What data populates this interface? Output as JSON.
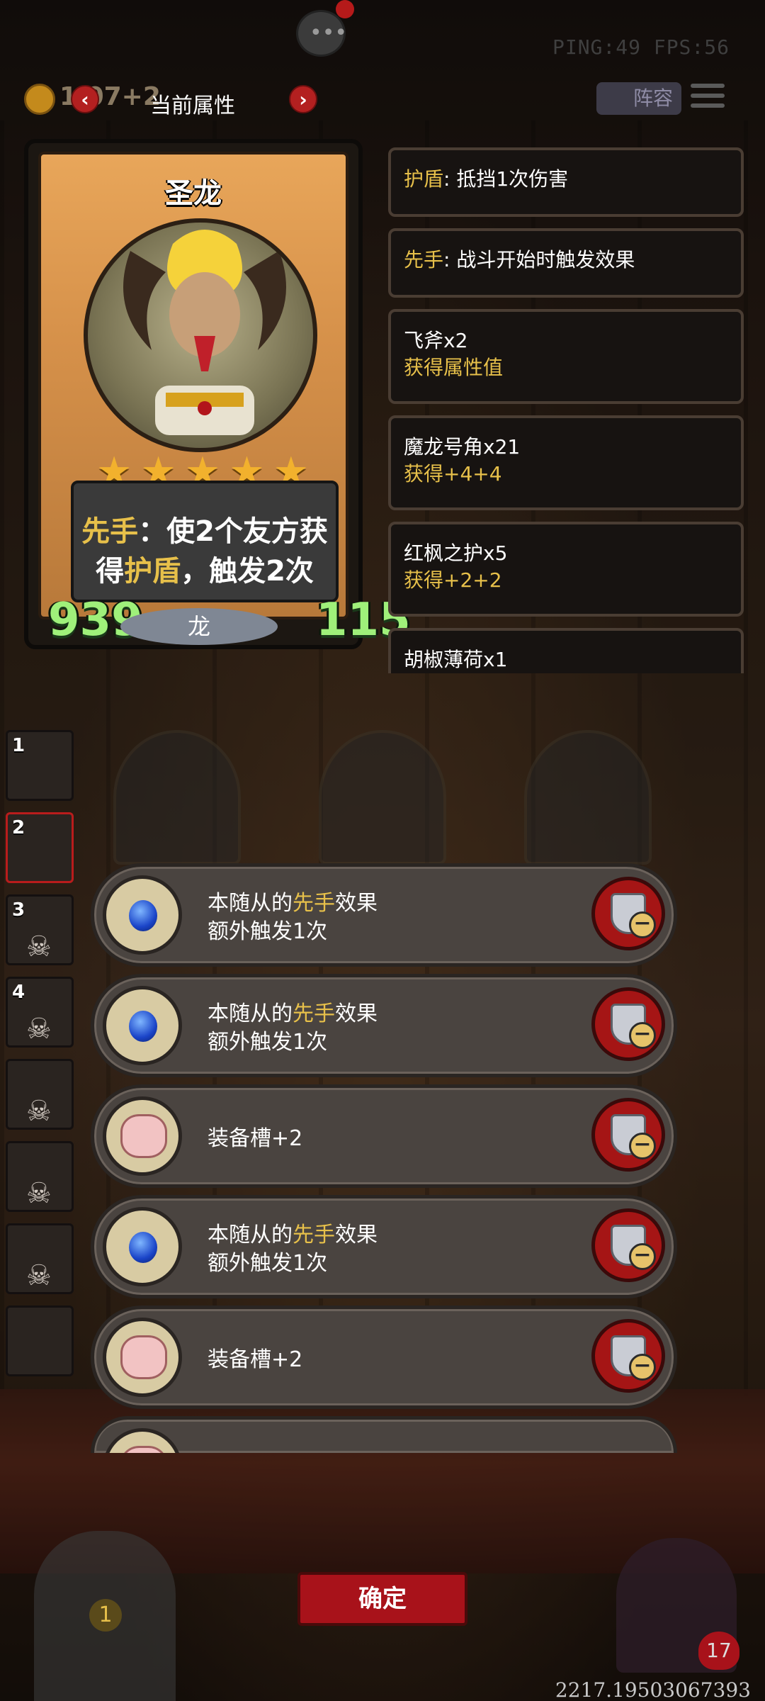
{
  "hud": {
    "ping_fps": "PING:49   FPS:56",
    "gold": "1  07+2",
    "lineup_label": "阵容",
    "prev_arrow": "‹",
    "next_arrow": "›",
    "panel_title": "当前属性",
    "chat_icon": "chat-icon"
  },
  "card": {
    "name": "圣龙",
    "stars": 5,
    "desc_line1_pre": "先手",
    "desc_line1_post": "：使2个友方获",
    "desc_line2_pre": "得",
    "desc_line2_gold": "护盾",
    "desc_line2_post": "，触发2次",
    "attack": "939",
    "tribe": "龙",
    "health": "115"
  },
  "attributes": [
    {
      "label_hl": "护盾",
      "label_rest": ": 抵挡1次伤害",
      "sub": ""
    },
    {
      "label_hl": "先手",
      "label_rest": ": 战斗开始时触发效果",
      "sub": ""
    },
    {
      "label_hl": "",
      "label_rest": "飞斧x2",
      "sub": "获得属性值"
    },
    {
      "label_hl": "",
      "label_rest": "魔龙号角x21",
      "sub": "获得+4+4"
    },
    {
      "label_hl": "",
      "label_rest": "红枫之护x5",
      "sub": "获得+2+2"
    },
    {
      "label_hl": "",
      "label_rest": "胡椒薄荷x1",
      "sub": ""
    }
  ],
  "roster": [
    "1",
    "2",
    "3",
    "4",
    "",
    "",
    "",
    ""
  ],
  "effects": [
    {
      "icon": "gem-icon",
      "line1_pre": "本随从的",
      "line1_gold": "先手",
      "line1_post": "效果",
      "line2": "额外触发1次"
    },
    {
      "icon": "gem-icon",
      "line1_pre": "本随从的",
      "line1_gold": "先手",
      "line1_post": "效果",
      "line2": "额外触发1次"
    },
    {
      "icon": "pig-icon",
      "line1_pre": "装备槽+2",
      "line1_gold": "",
      "line1_post": "",
      "line2": ""
    },
    {
      "icon": "gem-icon",
      "line1_pre": "本随从的",
      "line1_gold": "先手",
      "line1_post": "效果",
      "line2": "额外触发1次"
    },
    {
      "icon": "pig-icon",
      "line1_pre": "装备槽+2",
      "line1_gold": "",
      "line1_post": "",
      "line2": ""
    }
  ],
  "confirm_label": "确定",
  "hero_hp": "17",
  "door_badge": "1",
  "coord_readout": "2217.19503067393",
  "colors": {
    "accent_gold": "#e7c04a",
    "stat_green": "#9ff07a",
    "remove_red": "#a51515"
  }
}
